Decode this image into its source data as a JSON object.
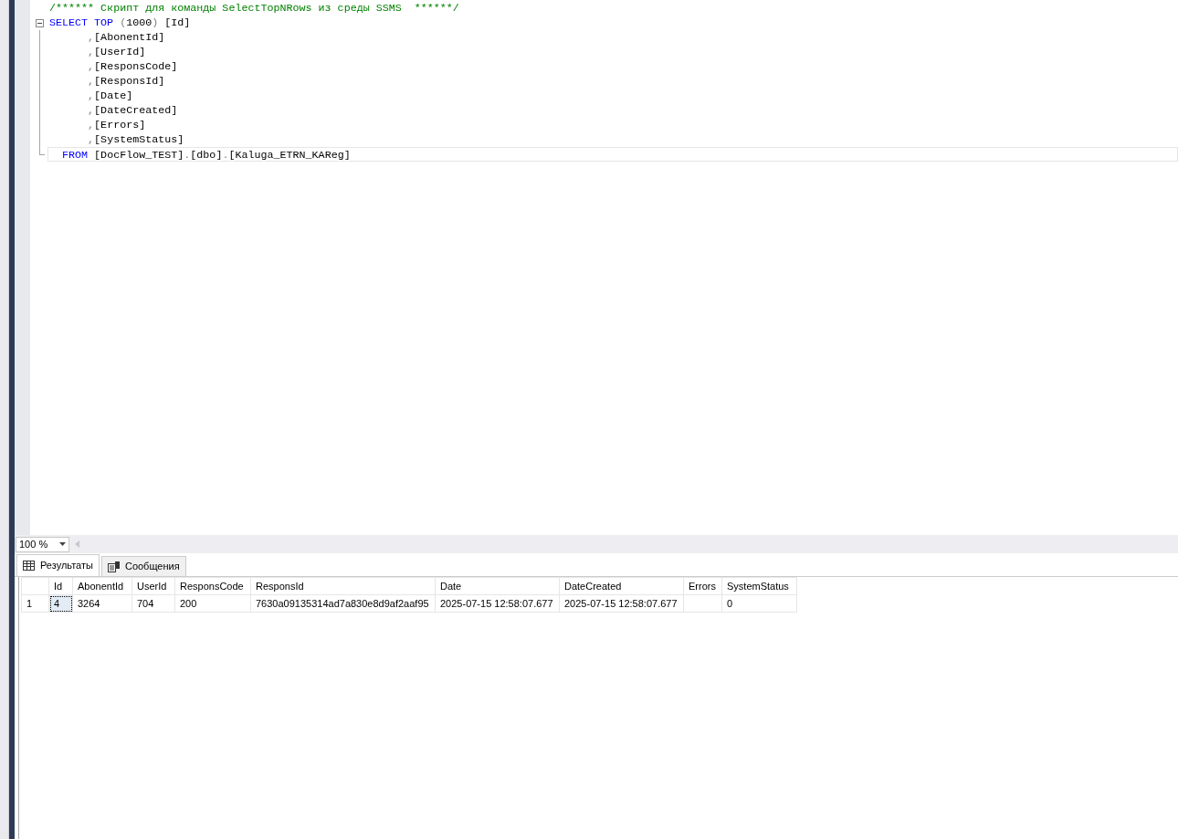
{
  "editor": {
    "lines": [
      {
        "kind": "plain",
        "current": false,
        "segments": [
          {
            "kind": "comment",
            "text": "/****** Скрипт для команды SelectTopNRows из среды SSMS  ******/"
          }
        ]
      },
      {
        "kind": "fold-start",
        "current": false,
        "segments": [
          {
            "kind": "keyword",
            "text": "SELECT TOP "
          },
          {
            "kind": "punct",
            "text": "("
          },
          {
            "kind": "plain",
            "text": "1000"
          },
          {
            "kind": "punct",
            "text": ")"
          },
          {
            "kind": "plain",
            "text": " [Id]"
          }
        ]
      },
      {
        "kind": "fold-body",
        "current": false,
        "segments": [
          {
            "kind": "punct",
            "text": "      ,"
          },
          {
            "kind": "plain",
            "text": "[AbonentId]"
          }
        ]
      },
      {
        "kind": "fold-body",
        "current": false,
        "segments": [
          {
            "kind": "punct",
            "text": "      ,"
          },
          {
            "kind": "plain",
            "text": "[UserId]"
          }
        ]
      },
      {
        "kind": "fold-body",
        "current": false,
        "segments": [
          {
            "kind": "punct",
            "text": "      ,"
          },
          {
            "kind": "plain",
            "text": "[ResponsCode]"
          }
        ]
      },
      {
        "kind": "fold-body",
        "current": false,
        "segments": [
          {
            "kind": "punct",
            "text": "      ,"
          },
          {
            "kind": "plain",
            "text": "[ResponsId]"
          }
        ]
      },
      {
        "kind": "fold-body",
        "current": false,
        "segments": [
          {
            "kind": "punct",
            "text": "      ,"
          },
          {
            "kind": "plain",
            "text": "[Date]"
          }
        ]
      },
      {
        "kind": "fold-body",
        "current": false,
        "segments": [
          {
            "kind": "punct",
            "text": "      ,"
          },
          {
            "kind": "plain",
            "text": "[DateCreated]"
          }
        ]
      },
      {
        "kind": "fold-body",
        "current": false,
        "segments": [
          {
            "kind": "punct",
            "text": "      ,"
          },
          {
            "kind": "plain",
            "text": "[Errors]"
          }
        ]
      },
      {
        "kind": "fold-body",
        "current": false,
        "segments": [
          {
            "kind": "punct",
            "text": "      ,"
          },
          {
            "kind": "plain",
            "text": "[SystemStatus]"
          }
        ]
      },
      {
        "kind": "fold-end",
        "current": true,
        "segments": [
          {
            "kind": "keyword",
            "text": "  FROM "
          },
          {
            "kind": "plain",
            "text": "[DocFlow_TEST]"
          },
          {
            "kind": "punct",
            "text": "."
          },
          {
            "kind": "plain",
            "text": "[dbo]"
          },
          {
            "kind": "punct",
            "text": "."
          },
          {
            "kind": "plain",
            "text": "[Kaluga_ETRN_KAReg]"
          }
        ]
      }
    ]
  },
  "zoom": {
    "value": "100 %"
  },
  "tabs": [
    {
      "label": "Результаты",
      "kind": "grid",
      "selected": true
    },
    {
      "label": "Сообщения",
      "kind": "messages",
      "selected": false
    }
  ],
  "grid": {
    "columns": [
      "Id",
      "AbonentId",
      "UserId",
      "ResponsCode",
      "ResponsId",
      "Date",
      "DateCreated",
      "Errors",
      "SystemStatus"
    ],
    "rows": [
      {
        "number": "1",
        "cells": [
          {
            "text": "4",
            "selected": true
          },
          {
            "text": "3264",
            "selected": false
          },
          {
            "text": "704",
            "selected": false
          },
          {
            "text": "200",
            "selected": false
          },
          {
            "text": "7630a09135314ad7a830e8d9af2aaf95",
            "selected": false
          },
          {
            "text": "2025-07-15 12:58:07.677",
            "selected": false
          },
          {
            "text": "2025-07-15 12:58:07.677",
            "selected": false
          },
          {
            "text": "",
            "selected": false
          },
          {
            "text": "0",
            "selected": false
          }
        ]
      }
    ]
  }
}
